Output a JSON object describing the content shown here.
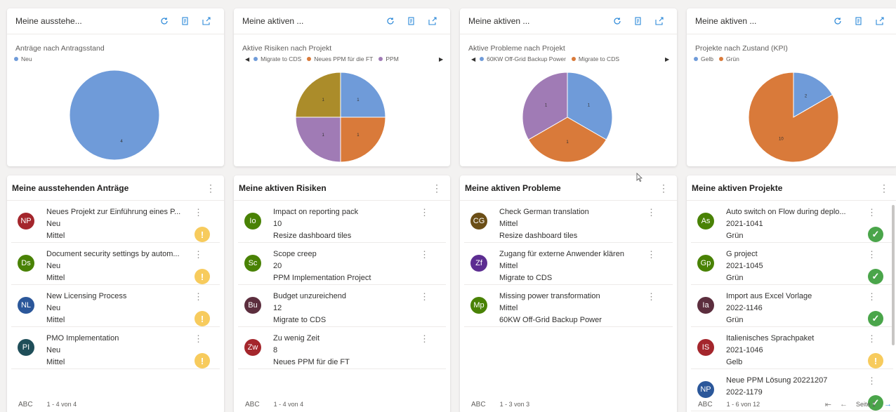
{
  "charts": [
    {
      "title": "Meine ausstehe...",
      "subtitle": "Anträge nach Antragsstand",
      "chart_data": {
        "type": "pie",
        "series": [
          {
            "name": "Neu",
            "value": 4,
            "color": "#6f9bd9"
          }
        ]
      }
    },
    {
      "title": "Meine aktiven ...",
      "subtitle": "Aktive Risiken nach Projekt",
      "chart_data": {
        "type": "pie",
        "series": [
          {
            "name": "Migrate to CDS",
            "value": 1,
            "color": "#6f9bd9"
          },
          {
            "name": "Neues PPM für die FT",
            "value": 1,
            "color": "#d97a3a"
          },
          {
            "name": "PPM",
            "value": 1,
            "color": "#a07bb5"
          },
          {
            "value": 1,
            "color": "#ab8c2a"
          }
        ]
      }
    },
    {
      "title": "Meine aktiven ...",
      "subtitle": "Aktive Probleme nach Projekt",
      "chart_data": {
        "type": "pie",
        "series": [
          {
            "name": "60KW Off-Grid Backup Power",
            "value": 1,
            "color": "#6f9bd9"
          },
          {
            "name": "Migrate to CDS",
            "value": 1,
            "color": "#d97a3a"
          },
          {
            "value": 1,
            "color": "#a07bb5"
          }
        ]
      }
    },
    {
      "title": "Meine aktiven ...",
      "subtitle": "Projekte nach Zustand (KPI)",
      "chart_data": {
        "type": "pie",
        "series": [
          {
            "name": "Gelb",
            "value": 2,
            "color": "#6f9bd9"
          },
          {
            "name": "Grün",
            "value": 10,
            "color": "#d97a3a"
          }
        ]
      }
    }
  ],
  "lists": [
    {
      "title": "Meine ausstehenden Anträge",
      "footer_abc": "ABC",
      "footer_count": "1 - 4 von 4",
      "rows": [
        {
          "initials": "NP",
          "color": "#a4262c",
          "lines": [
            "Neues Projekt zur Einführung eines P...",
            "Neu",
            "Mittel"
          ],
          "status": "warn"
        },
        {
          "initials": "Ds",
          "color": "#498205",
          "lines": [
            "Document security settings by autom...",
            "Neu",
            "Mittel"
          ],
          "status": "warn"
        },
        {
          "initials": "NL",
          "color": "#2b579a",
          "lines": [
            "New Licensing Process",
            "Neu",
            "Mittel"
          ],
          "status": "warn"
        },
        {
          "initials": "PI",
          "color": "#1f4e59",
          "lines": [
            "PMO Implementation",
            "Neu",
            "Mittel"
          ],
          "status": "warn"
        }
      ]
    },
    {
      "title": "Meine aktiven Risiken",
      "footer_abc": "ABC",
      "footer_count": "1 - 4 von 4",
      "rows": [
        {
          "initials": "Io",
          "color": "#498205",
          "lines": [
            "Impact on reporting pack",
            "10",
            "Resize dashboard tiles"
          ],
          "status": ""
        },
        {
          "initials": "Sc",
          "color": "#498205",
          "lines": [
            "Scope creep",
            "20",
            "PPM Implementation Project"
          ],
          "status": ""
        },
        {
          "initials": "Bu",
          "color": "#5c2e3e",
          "lines": [
            "Budget unzureichend",
            "12",
            "Migrate to CDS"
          ],
          "status": ""
        },
        {
          "initials": "Zw",
          "color": "#a4262c",
          "lines": [
            "Zu wenig Zeit",
            "8",
            "Neues PPM für die FT"
          ],
          "status": ""
        }
      ]
    },
    {
      "title": "Meine aktiven Probleme",
      "footer_abc": "ABC",
      "footer_count": "1 - 3 von 3",
      "rows": [
        {
          "initials": "CG",
          "color": "#6b4e16",
          "lines": [
            "Check German translation",
            "Mittel",
            "Resize dashboard tiles"
          ],
          "status": ""
        },
        {
          "initials": "Zf",
          "color": "#5c2d91",
          "lines": [
            "Zugang für externe Anwender klären",
            "Mittel",
            "Migrate to CDS"
          ],
          "status": ""
        },
        {
          "initials": "Mp",
          "color": "#498205",
          "lines": [
            "Missing power transformation",
            "Mittel",
            "60KW Off-Grid Backup Power"
          ],
          "status": ""
        }
      ]
    },
    {
      "title": "Meine aktiven Projekte",
      "footer_abc": "ABC",
      "footer_count": "1 - 6 von 12",
      "page_label": "Seite 1",
      "rows": [
        {
          "initials": "As",
          "color": "#498205",
          "lines": [
            "Auto switch on Flow during deplo...",
            "2021-1041",
            "Grün"
          ],
          "status": "ok"
        },
        {
          "initials": "Gp",
          "color": "#498205",
          "lines": [
            "G project",
            "2021-1045",
            "Grün"
          ],
          "status": "ok"
        },
        {
          "initials": "Ia",
          "color": "#5c2e3e",
          "lines": [
            "Import aus Excel Vorlage",
            "2022-1146",
            "Grün"
          ],
          "status": "ok"
        },
        {
          "initials": "IS",
          "color": "#a4262c",
          "lines": [
            "Italienisches Sprachpaket",
            "2021-1046",
            "Gelb"
          ],
          "status": "warn"
        },
        {
          "initials": "NP",
          "color": "#2b579a",
          "lines": [
            "Neue PPM Lösung 20221207",
            "2022-1179",
            ""
          ],
          "status": "ok"
        }
      ]
    }
  ],
  "icons": {
    "refresh": "refresh-icon",
    "export": "export-icon",
    "expand": "expand-icon",
    "kebab": "more-icon",
    "warn_glyph": "!",
    "ok_glyph": "✓"
  }
}
